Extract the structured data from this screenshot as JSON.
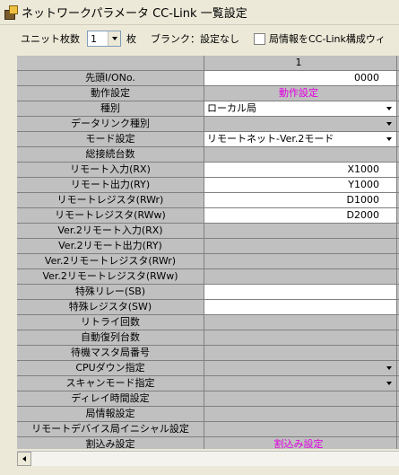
{
  "window": {
    "title": "ネットワークパラメータ  CC-Link 一覧設定",
    "icon": "network-app-icon"
  },
  "toolbar": {
    "unit_label": "ユニット枚数",
    "unit_value": "1",
    "unit_suffix": "枚",
    "blank_label": "ブランク：設定なし",
    "local_station_label": "局情報をCC-Link構成ウィ"
  },
  "grid": {
    "column_header": "1",
    "rows": [
      {
        "label": "先頭I/ONo.",
        "value": "0000",
        "style": "white",
        "align": "right",
        "dropdown": false
      },
      {
        "label": "動作設定",
        "value": "動作設定",
        "style": "gray",
        "align": "center",
        "dropdown": false
      },
      {
        "label": "種別",
        "value": "ローカル局",
        "style": "white",
        "align": "left",
        "dropdown": true
      },
      {
        "label": "データリンク種別",
        "value": "",
        "style": "gray",
        "align": "left",
        "dropdown": true
      },
      {
        "label": "モード設定",
        "value": "リモートネット-Ver.2モード",
        "style": "white",
        "align": "left",
        "dropdown": true
      },
      {
        "label": "総接続台数",
        "value": "",
        "style": "gray",
        "align": "left",
        "dropdown": false
      },
      {
        "label": "リモート入力(RX)",
        "value": "X1000",
        "style": "white",
        "align": "right",
        "dropdown": false
      },
      {
        "label": "リモート出力(RY)",
        "value": "Y1000",
        "style": "white",
        "align": "right",
        "dropdown": false
      },
      {
        "label": "リモートレジスタ(RWr)",
        "value": "D1000",
        "style": "white",
        "align": "right",
        "dropdown": false
      },
      {
        "label": "リモートレジスタ(RWw)",
        "value": "D2000",
        "style": "white",
        "align": "right",
        "dropdown": false
      },
      {
        "label": "Ver.2リモート入力(RX)",
        "value": "",
        "style": "gray",
        "align": "left",
        "dropdown": false
      },
      {
        "label": "Ver.2リモート出力(RY)",
        "value": "",
        "style": "gray",
        "align": "left",
        "dropdown": false
      },
      {
        "label": "Ver.2リモートレジスタ(RWr)",
        "value": "",
        "style": "gray",
        "align": "left",
        "dropdown": false
      },
      {
        "label": "Ver.2リモートレジスタ(RWw)",
        "value": "",
        "style": "gray",
        "align": "left",
        "dropdown": false
      },
      {
        "label": "特殊リレー(SB)",
        "value": "",
        "style": "white",
        "align": "left",
        "dropdown": false
      },
      {
        "label": "特殊レジスタ(SW)",
        "value": "",
        "style": "white",
        "align": "left",
        "dropdown": false
      },
      {
        "label": "リトライ回数",
        "value": "",
        "style": "gray",
        "align": "left",
        "dropdown": false
      },
      {
        "label": "自動復列台数",
        "value": "",
        "style": "gray",
        "align": "left",
        "dropdown": false
      },
      {
        "label": "待機マスタ局番号",
        "value": "",
        "style": "gray",
        "align": "left",
        "dropdown": false
      },
      {
        "label": "CPUダウン指定",
        "value": "",
        "style": "gray",
        "align": "left",
        "dropdown": true
      },
      {
        "label": "スキャンモード指定",
        "value": "",
        "style": "gray",
        "align": "left",
        "dropdown": true
      },
      {
        "label": "ディレイ時間設定",
        "value": "",
        "style": "gray",
        "align": "left",
        "dropdown": false
      },
      {
        "label": "局情報設定",
        "value": "",
        "style": "gray",
        "align": "left",
        "dropdown": false
      },
      {
        "label": "リモートデバイス局イニシャル設定",
        "value": "",
        "style": "gray",
        "align": "left",
        "dropdown": false
      },
      {
        "label": "割込み設定",
        "value": "割込み設定",
        "style": "gray",
        "align": "center",
        "dropdown": false
      }
    ]
  },
  "colors": {
    "accent_link": "#e000e0",
    "cell_gray": "#c0c0c0",
    "window_bg": "#ece9d8"
  }
}
